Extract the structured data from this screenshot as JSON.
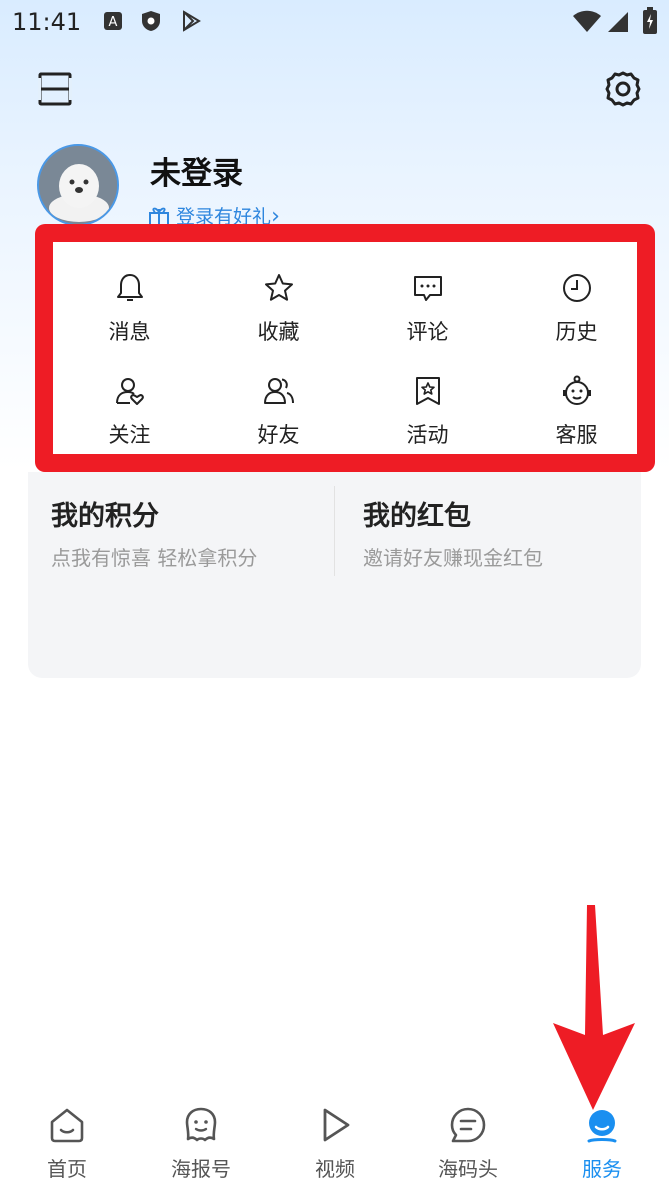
{
  "status_bar": {
    "time": "11:41",
    "icons": [
      "a-badge-icon",
      "shield-icon",
      "play-store-icon",
      "wifi-icon",
      "signal-icon",
      "battery-icon"
    ]
  },
  "header": {
    "menu_icon": "menu-icon",
    "settings_icon": "gear-icon"
  },
  "profile": {
    "title": "未登录",
    "gift_text": "登录有好礼",
    "chevron": "›"
  },
  "grid": [
    {
      "label": "消息",
      "icon": "bell-icon"
    },
    {
      "label": "收藏",
      "icon": "star-icon"
    },
    {
      "label": "评论",
      "icon": "comment-icon"
    },
    {
      "label": "历史",
      "icon": "clock-icon"
    },
    {
      "label": "关注",
      "icon": "person-heart-icon"
    },
    {
      "label": "好友",
      "icon": "friends-icon"
    },
    {
      "label": "活动",
      "icon": "bookmark-star-icon"
    },
    {
      "label": "客服",
      "icon": "service-icon"
    }
  ],
  "cards": {
    "points": {
      "title": "我的积分",
      "subtitle": "点我有惊喜 轻松拿积分"
    },
    "redpacket": {
      "title": "我的红包",
      "subtitle": "邀请好友赚现金红包"
    }
  },
  "bottom_nav": [
    {
      "label": "首页",
      "icon": "home-icon",
      "active": false
    },
    {
      "label": "海报号",
      "icon": "ghost-icon",
      "active": false
    },
    {
      "label": "视频",
      "icon": "play-icon",
      "active": false
    },
    {
      "label": "海码头",
      "icon": "chat-bubble-icon",
      "active": false
    },
    {
      "label": "服务",
      "icon": "service-person-icon",
      "active": true
    }
  ],
  "colors": {
    "accent": "#1a8ff0",
    "highlight_red": "#ee1c25",
    "link_blue": "#2e86de"
  }
}
